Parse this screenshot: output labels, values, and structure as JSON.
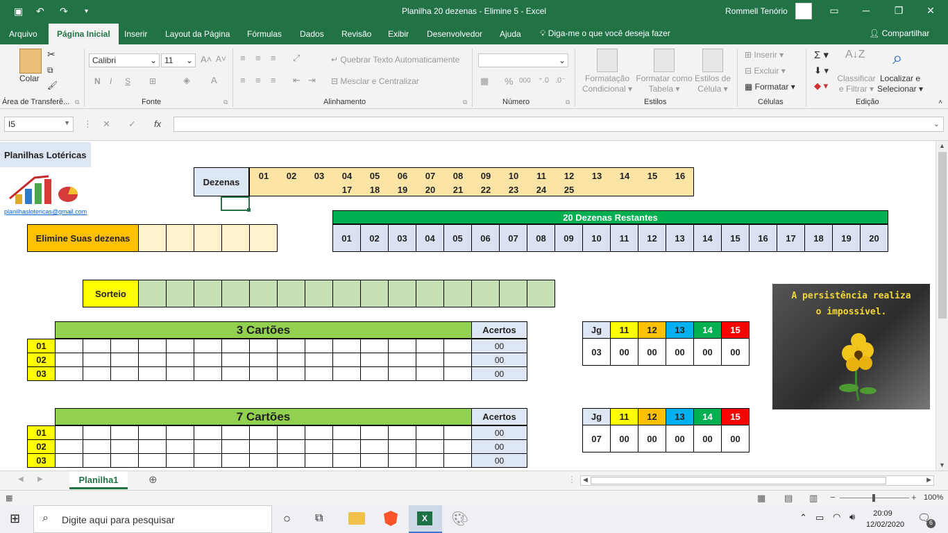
{
  "titlebar": {
    "title": "Planilha 20 dezenas - Elimine 5  -  Excel",
    "user": "Rommell Tenório"
  },
  "menu": [
    "Arquivo",
    "Página Inicial",
    "Inserir",
    "Layout da Página",
    "Fórmulas",
    "Dados",
    "Revisão",
    "Exibir",
    "Desenvolvedor",
    "Ajuda"
  ],
  "tellme": "Diga-me o que você deseja fazer",
  "share": "Compartilhar",
  "ribbon": {
    "colar": "Colar",
    "font_name": "Calibri",
    "font_size": "11",
    "bold": "N",
    "italic": "I",
    "underline": "S",
    "quebrar": "Quebrar Texto Automaticamente",
    "mesclar": "Mesclar e Centralizar",
    "percent": "%",
    "thousands": "000",
    "cond_format": "Formatação Condicional",
    "cond_format_a": "Formatação",
    "cond_format_b": "Condicional",
    "format_table_a": "Formatar como",
    "format_table_b": "Tabela",
    "cell_styles_a": "Estilos de",
    "cell_styles_b": "Célula",
    "inserir": "Inserir",
    "excluir": "Excluir",
    "formatar": "Formatar",
    "classificar_a": "Classificar",
    "classificar_b": "e Filtrar",
    "localizar_a": "Localizar e",
    "localizar_b": "Selecionar",
    "groups": {
      "clipboard": "Área de Transferê...",
      "fonte": "Fonte",
      "alinhamento": "Alinhamento",
      "numero": "Número",
      "estilos": "Estilos",
      "celulas": "Células",
      "edicao": "Edição"
    }
  },
  "formula": {
    "namebox": "I5",
    "value": ""
  },
  "sheet": {
    "brand": "Planilhas Lotéricas",
    "email": "planilhaslotericas@gmail.com",
    "dezenas_label": "Dezenas",
    "dezenas_row1": [
      "01",
      "02",
      "03",
      "04",
      "05",
      "06",
      "07",
      "08",
      "09",
      "10",
      "11",
      "12",
      "13",
      "14",
      "15",
      "16"
    ],
    "dezenas_row2": [
      "17",
      "18",
      "19",
      "20",
      "21",
      "22",
      "23",
      "24",
      "25"
    ],
    "restantes_title": "20 Dezenas Restantes",
    "restantes": [
      "01",
      "02",
      "03",
      "04",
      "05",
      "06",
      "07",
      "08",
      "09",
      "10",
      "11",
      "12",
      "13",
      "14",
      "15",
      "16",
      "17",
      "18",
      "19",
      "20"
    ],
    "elimine_label": "Elimine Suas dezenas",
    "sorteio_label": "Sorteio",
    "block1": {
      "title": "3 Cartões",
      "acertos": "Acertos",
      "rows": [
        "01",
        "02",
        "03"
      ],
      "values": [
        "00",
        "00",
        "00"
      ]
    },
    "block2": {
      "title": "7 Cartões",
      "acertos": "Acertos",
      "rows": [
        "01",
        "02",
        "03"
      ],
      "values": [
        "00",
        "00",
        "00"
      ]
    },
    "summary1": {
      "jg_label": "Jg",
      "headers": [
        "11",
        "12",
        "13",
        "14",
        "15"
      ],
      "jg": "03",
      "values": [
        "00",
        "00",
        "00",
        "00",
        "00"
      ]
    },
    "summary2": {
      "jg_label": "Jg",
      "headers": [
        "11",
        "12",
        "13",
        "14",
        "15"
      ],
      "jg": "07",
      "values": [
        "00",
        "00",
        "00",
        "00",
        "00"
      ]
    },
    "quote_line1": "A persistência realiza",
    "quote_line2": "o impossível."
  },
  "sheettab": "Planilha1",
  "status": {
    "zoom": "100%"
  },
  "taskbar": {
    "search": "Digite aqui para pesquisar",
    "time": "20:09",
    "date": "12/02/2020",
    "notif": "6"
  }
}
